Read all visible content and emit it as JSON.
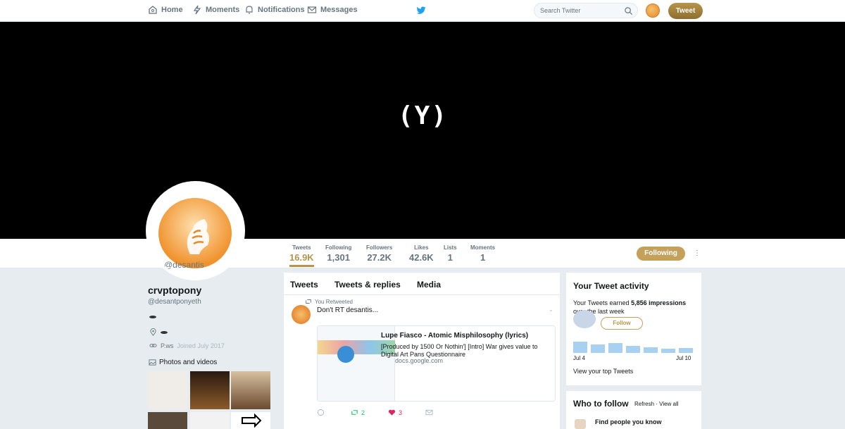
{
  "nav": {
    "home": "Home",
    "moments": "Moments",
    "notifications": "Notifications",
    "messages": "Messages",
    "search_placeholder": "Search Twitter",
    "tweet_button": "Tweet"
  },
  "banner": {
    "text": "(Y)"
  },
  "profile": {
    "name": "crvptopony",
    "handle": "@desantponyeth",
    "avatar_handle": "@desantis",
    "location": "",
    "website": "P.ws",
    "joined": "Joined July 2017",
    "photos_label": "Photos and videos"
  },
  "stats": [
    {
      "label": "Tweets",
      "value": "16.9K"
    },
    {
      "label": "Following",
      "value": "1,301"
    },
    {
      "label": "Followers",
      "value": "27.2K"
    },
    {
      "label": "Likes",
      "value": "42.6K"
    },
    {
      "label": "Lists",
      "value": "1"
    },
    {
      "label": "Moments",
      "value": "1"
    }
  ],
  "following_button": "Following",
  "timeline": {
    "tabs": [
      "Tweets",
      "Tweets & replies",
      "Media"
    ],
    "retweeted_label": "You Retweeted",
    "tweet_text": "Don't RT desantis...",
    "card": {
      "title": "Lupe Fiasco - Atomic Misphilosophy (lyrics)",
      "description": "[Produced by 1500 Or Nothin'] [Intro] War gives value to Digital Art Pans Questionnaire",
      "domain": "docs.google.com"
    },
    "actions": {
      "replies": "",
      "retweets": "2",
      "likes": "3"
    }
  },
  "activity": {
    "title": "Your Tweet activity",
    "desc_prefix": "Your Tweets earned ",
    "impressions": "5,856 impressions",
    "desc_suffix": " over the last week",
    "follow_button": "Follow",
    "date_start": "Jul 4",
    "date_end": "Jul 10",
    "view_top": "View your top Tweets"
  },
  "who_to_follow": {
    "title": "Who to follow",
    "refresh": "Refresh",
    "separator": " · ",
    "view_all": "View all",
    "find_people": "Find people you know"
  },
  "colors": {
    "accent": "#b8944a",
    "like": "#e0245e",
    "retweet": "#17bf63",
    "twitter_blue": "#1da1f2"
  }
}
